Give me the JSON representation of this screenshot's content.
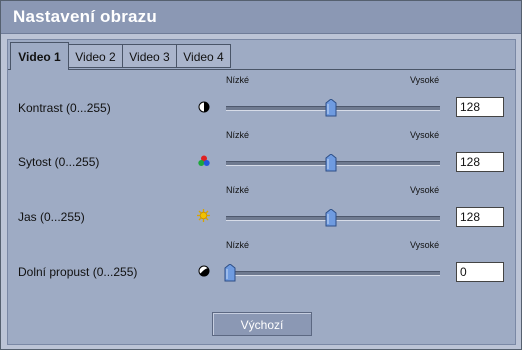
{
  "window": {
    "title": "Nastavení obrazu"
  },
  "tabs": [
    {
      "label": "Video 1",
      "active": true
    },
    {
      "label": "Video 2",
      "active": false
    },
    {
      "label": "Video 3",
      "active": false
    },
    {
      "label": "Video 4",
      "active": false
    }
  ],
  "scale": {
    "low": "Nízké",
    "high": "Vysoké"
  },
  "settings": [
    {
      "label": "Kontrast (0...255)",
      "icon": "contrast-icon",
      "value": "128",
      "level": 128,
      "max": 255
    },
    {
      "label": "Sytost (0...255)",
      "icon": "saturation-icon",
      "value": "128",
      "level": 128,
      "max": 255
    },
    {
      "label": "Jas (0...255)",
      "icon": "brightness-icon",
      "value": "128",
      "level": 128,
      "max": 255
    },
    {
      "label": "Dolní propust (0...255)",
      "icon": "low-pass-filter-icon",
      "value": "0",
      "level": 0,
      "max": 255
    }
  ],
  "buttons": {
    "default_label": "Výchozí"
  },
  "colors": {
    "title_bar": "#8b98b4",
    "panel": "#9eabc4",
    "window": "#bcc4d6",
    "thumb": "#6f9be0",
    "brightness_icon": "#f2c200"
  }
}
